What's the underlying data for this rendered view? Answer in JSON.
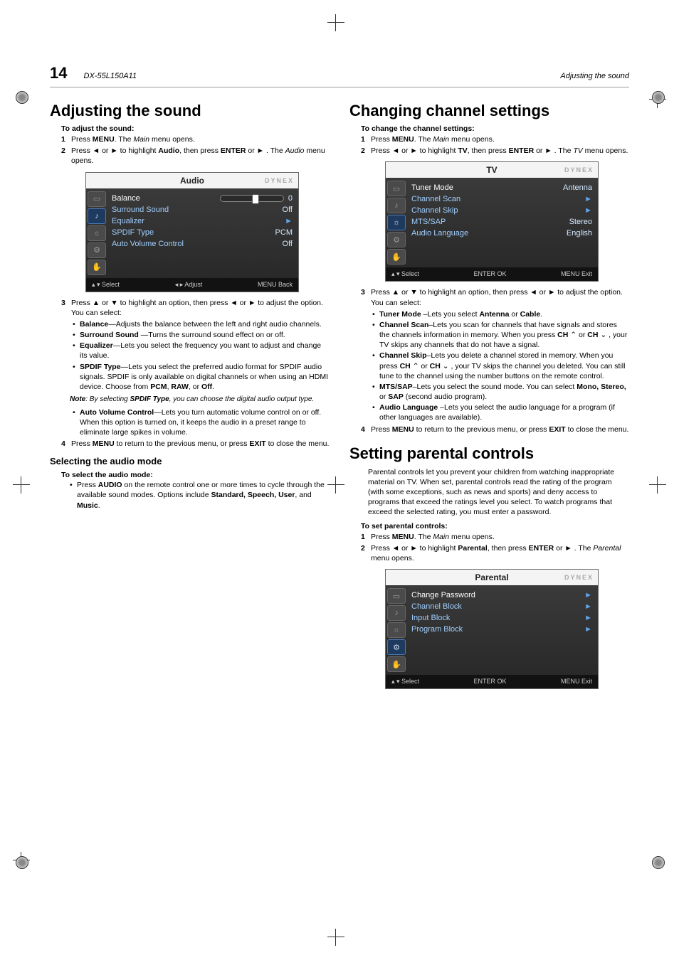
{
  "page_number": "14",
  "model": "DX-55L150A11",
  "header_right": "Adjusting the sound",
  "left": {
    "title": "Adjusting the sound",
    "ta_heading": "To adjust the sound:",
    "steps": [
      {
        "n": "1",
        "pre": "Press ",
        "b1": "MENU",
        "mid1": ". The ",
        "i1": "Main",
        "post": " menu opens."
      },
      {
        "n": "2",
        "pre": "Press ",
        "tri1": "◄",
        "mid1": " or ",
        "tri2": "►",
        "mid2": " to highlight ",
        "b1": "Audio",
        "mid3": ", then press ",
        "b2": "ENTER",
        "mid4": " or ",
        "tri3": "►",
        "mid5": " . The ",
        "i1": "Audio",
        "post": " menu opens."
      }
    ],
    "osd": {
      "title": "Audio",
      "brand": "DYNEX",
      "rows": [
        {
          "label": "Balance",
          "value": "0",
          "slider": true,
          "active": true
        },
        {
          "label": "Surround Sound",
          "value": "Off"
        },
        {
          "label": "Equalizer",
          "value_arrow": "►"
        },
        {
          "label": "SPDIF Type",
          "value": "PCM"
        },
        {
          "label": "Auto Volume Control",
          "value": "Off"
        }
      ],
      "footer_left": "▴ ▾  Select",
      "footer_mid": "◂ ▸  Adjust",
      "footer_right": "MENU  Back"
    },
    "step3": {
      "n": "3",
      "pre": "Press ",
      "tri1": "▲",
      "mid1": " or ",
      "tri2": "▼",
      "mid2": " to highlight an option, then press ",
      "tri3": "◄",
      "mid3": " or ",
      "tri4": "►",
      "post": " to adjust the option. You can select:"
    },
    "bullets": [
      {
        "b": "Balance",
        "t": "—Adjusts the balance between the left and right audio channels."
      },
      {
        "b": "Surround Sound ",
        "t": "—Turns the surround sound effect on or off."
      },
      {
        "b": "Equalizer",
        "t": "—Lets you select the frequency you want to adjust and change its value."
      },
      {
        "b": "SPDIF Type",
        "t": "—Lets you select the preferred audio format for SPDIF audio signals. SPDIF is only available on digital channels or when using an HDMI device. Choose from PCM, RAW, or Off.",
        "boldtail": [
          "PCM",
          "RAW",
          "Off"
        ]
      }
    ],
    "note": {
      "pre": "Note",
      "mid1": ": By selecting ",
      "b": "SPDIF Type",
      "post": ", you can choose the digital audio output type."
    },
    "bullet_avc": {
      "b": "Auto Volume Control",
      "t": "—Lets you turn automatic volume control on or off. When this option is turned on, it keeps the audio in a preset range to eliminate large spikes in volume."
    },
    "step4": {
      "n": "4",
      "pre": "Press ",
      "b1": "MENU",
      "mid1": " to return to the previous menu, or press ",
      "b2": "EXIT",
      "post": " to close the menu."
    },
    "subtitle": "Selecting the audio mode",
    "ts_heading": "To select the audio mode:",
    "audio_mode_bullet": {
      "pre": "Press ",
      "b1": "AUDIO",
      "mid1": " on the remote control one or more times to cycle through the available sound modes. Options include ",
      "b2": "Standard, Speech, User",
      "mid2": ", and ",
      "b3": "Music",
      "post": "."
    }
  },
  "right": {
    "title1": "Changing channel settings",
    "tc_heading": "To change the channel settings:",
    "steps1": [
      {
        "n": "1",
        "pre": "Press ",
        "b1": "MENU",
        "mid1": ". The ",
        "i1": "Main",
        "post": " menu opens."
      },
      {
        "n": "2",
        "pre": "Press ",
        "tri1": "◄",
        "mid1": " or ",
        "tri2": "►",
        "mid2": " to highlight ",
        "b1": "TV",
        "mid3": ", then press ",
        "b2": "ENTER",
        "mid4": " or ",
        "tri3": "►",
        "mid5": " . The ",
        "i1": "TV",
        "post": " menu opens."
      }
    ],
    "osd_tv": {
      "title": "TV",
      "brand": "DYNEX",
      "rows": [
        {
          "label": "Tuner Mode",
          "value": "Antenna",
          "active": true
        },
        {
          "label": "Channel Scan",
          "value_arrow": "►"
        },
        {
          "label": "Channel Skip",
          "value_arrow": "►"
        },
        {
          "label": "MTS/SAP",
          "value": "Stereo"
        },
        {
          "label": "Audio Language",
          "value": "English"
        }
      ],
      "footer_left": "▴ ▾ Select",
      "footer_mid": "ENTER OK",
      "footer_right": "MENU Exit"
    },
    "step3": {
      "n": "3",
      "pre": "Press ",
      "tri1": "▲",
      "mid1": " or ",
      "tri2": "▼",
      "mid2": " to highlight an option, then press ",
      "tri3": "◄",
      "mid3": " or ",
      "tri4": "►",
      "post": " to adjust the option. You can select:"
    },
    "bullets": [
      {
        "b": "Tuner Mode ",
        "t": "–Lets you select ",
        "b2": "Antenna",
        "mid": " or ",
        "b3": "Cable",
        "post": "."
      },
      {
        "b": "Channel Scan",
        "t": "–Lets you scan for channels that have signals and stores the channels information in memory. When you press ",
        "b2": "CH ",
        "tri1": "⌃",
        "mid": " or ",
        "b3": "CH ",
        "tri2": "⌄",
        "post": " , your TV skips any channels that do not have a signal."
      },
      {
        "b": "Channel Skip",
        "t": "–Lets you delete a channel stored in memory. When you press ",
        "b2": "CH ",
        "tri1": "⌃",
        "mid": " or ",
        "b3": "CH ",
        "tri2": "⌄",
        "post": " , your TV skips the channel you deleted. You can still tune to the channel using the number buttons on the remote control."
      },
      {
        "b": "MTS/SAP",
        "t": "–Lets you select the sound mode. You can select ",
        "b2": "Mono, Stereo,",
        "mid": " or ",
        "b3": "SAP",
        "post": " (second audio program)."
      },
      {
        "b": "Audio Language ",
        "t": "–Lets you select the audio language for a program (if other languages are available)."
      }
    ],
    "step4": {
      "n": "4",
      "pre": "Press ",
      "b1": "MENU",
      "mid1": " to return to the previous menu, or press ",
      "b2": "EXIT",
      "post": " to close the menu."
    },
    "title2": "Setting parental controls",
    "pc_intro": "Parental controls let you prevent your children from watching inappropriate material on TV. When set, parental controls read the rating of the program (with some exceptions, such as news and sports) and deny access to programs that exceed the ratings level you select. To watch programs that exceed the selected rating, you must enter a password.",
    "tp_heading": "To set parental controls:",
    "steps2": [
      {
        "n": "1",
        "pre": "Press ",
        "b1": "MENU",
        "mid1": ". The ",
        "i1": "Main",
        "post": " menu opens."
      },
      {
        "n": "2",
        "pre": "Press ",
        "tri1": "◄",
        "mid1": " or ",
        "tri2": "►",
        "mid2": " to highlight ",
        "b1": "Parental",
        "mid3": ", then press ",
        "b2": "ENTER",
        "mid4": " or ",
        "tri3": "►",
        "mid5": " . The ",
        "i1": "Parental",
        "post": " menu opens."
      }
    ],
    "osd_parental": {
      "title": "Parental",
      "brand": "DYNEX",
      "rows": [
        {
          "label": "Change Password",
          "value_arrow": "►",
          "active": true
        },
        {
          "label": "Channel Block",
          "value_arrow": "►"
        },
        {
          "label": "Input Block",
          "value_arrow": "►"
        },
        {
          "label": "Program Block",
          "value_arrow": "►"
        }
      ],
      "footer_left": "▴ ▾  Select",
      "footer_mid": "ENTER OK",
      "footer_right": "MENU  Exit"
    }
  }
}
